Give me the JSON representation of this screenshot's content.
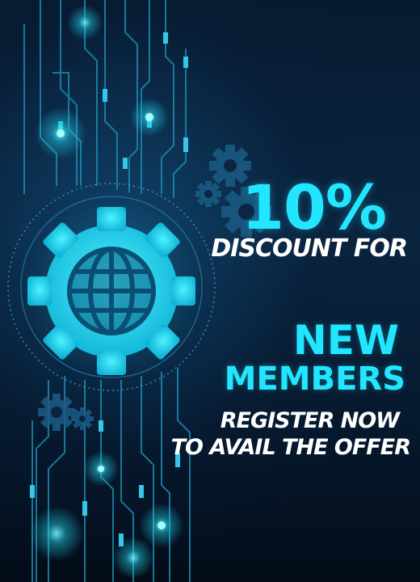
{
  "promo": {
    "discount_value": "10%",
    "discount_label": "DISCOUNT FOR",
    "audience_line1": "NEW",
    "audience_line2": "MEMBERS",
    "cta_line1": "REGISTER NOW",
    "cta_line2": "TO AVAIL THE OFFER"
  },
  "icons": [
    "gear-globe-icon",
    "gear-icon",
    "circuit-lines"
  ],
  "colors": {
    "background": "#071a30",
    "accent": "#22e6ff",
    "text": "#ffffff"
  }
}
